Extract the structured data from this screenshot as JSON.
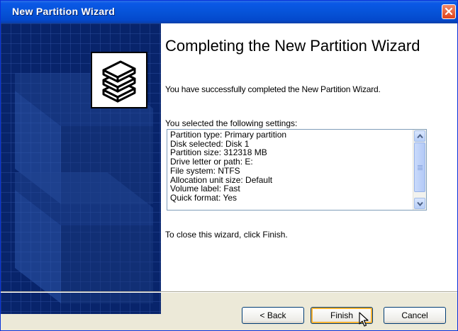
{
  "window": {
    "title": "New Partition Wizard"
  },
  "content": {
    "heading": "Completing the New Partition Wizard",
    "success_message": "You have successfully completed the New Partition Wizard.",
    "settings_label": "You selected the following settings:",
    "settings": [
      "Partition type: Primary partition",
      "Disk selected: Disk 1",
      "Partition size: 312318 MB",
      "Drive letter or path: E:",
      "File system: NTFS",
      "Allocation unit size: Default",
      "Volume label: Fast",
      "Quick format: Yes"
    ],
    "close_instruction": "To close this wizard, click Finish."
  },
  "buttons": {
    "back": "< Back",
    "finish": "Finish",
    "cancel": "Cancel"
  },
  "icons": {
    "close": "close-icon",
    "wizard": "disk-stack-icon",
    "scroll_up": "chevron-up-icon",
    "scroll_down": "chevron-down-icon",
    "cursor": "mouse-pointer-icon"
  },
  "colors": {
    "titlebar": "#0653d8",
    "banner": "#08246b",
    "close_button": "#e0421a",
    "default_button_glow": "#f8b333"
  }
}
